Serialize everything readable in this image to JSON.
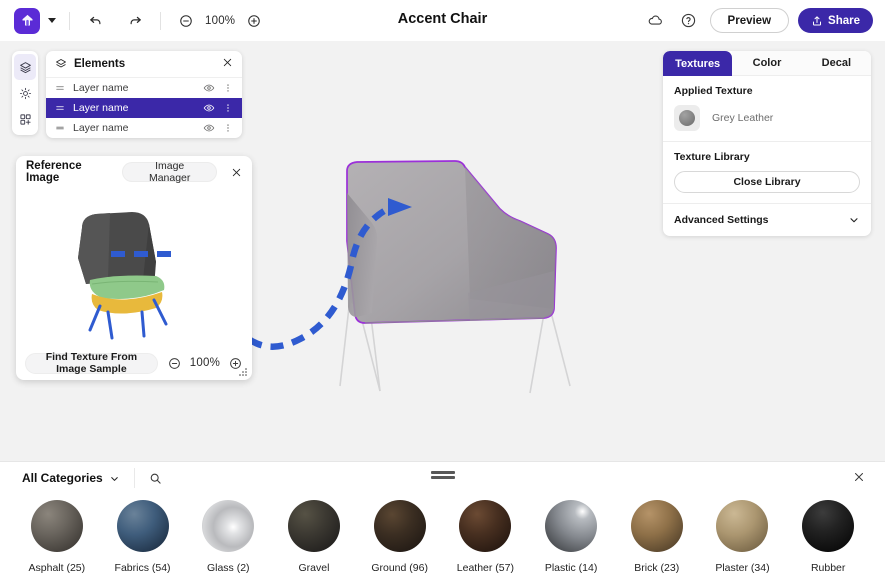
{
  "topbar": {
    "logo_icon": "app-logo-icon",
    "menu_caret_icon": "caret-down-icon",
    "undo_icon": "undo-icon",
    "redo_icon": "redo-icon",
    "zoom_out_icon": "minus-circle-icon",
    "zoom_in_icon": "plus-circle-icon",
    "zoom_level": "100%",
    "title": "Accent Chair",
    "cloud_icon": "cloud-icon",
    "help_icon": "question-circle-icon",
    "preview_label": "Preview",
    "share_label": "Share",
    "share_icon": "share-upload-icon"
  },
  "rail": {
    "items": [
      {
        "name": "layers-stack-icon",
        "active": true
      },
      {
        "name": "lighting-sun-icon",
        "active": false
      },
      {
        "name": "grid-apps-icon",
        "active": false
      }
    ]
  },
  "elements": {
    "header_icon": "layers-stack-icon",
    "title": "Elements",
    "close_icon": "close-icon",
    "rows": [
      {
        "label": "Layer name",
        "selected": false
      },
      {
        "label": "Layer name",
        "selected": true
      },
      {
        "label": "Layer name",
        "selected": false
      }
    ],
    "drag_icon": "drag-handle-icon",
    "eye_icon": "eye-visible-icon",
    "more_icon": "more-vertical-icon"
  },
  "reference": {
    "title": "Reference Image",
    "image_manager_label": "Image Manager",
    "close_icon": "close-icon",
    "find_texture_label": "Find Texture From Image Sample",
    "zoom_out_icon": "minus-circle-icon",
    "zoom_in_icon": "plus-circle-icon",
    "zoom_level": "100%",
    "resize_grip_icon": "resize-grip-icon",
    "thumbnail_alt": "reference-chair-photo"
  },
  "rightpanel": {
    "tabs": [
      {
        "label": "Textures",
        "active": true
      },
      {
        "label": "Color",
        "active": false
      },
      {
        "label": "Decal",
        "active": false
      }
    ],
    "applied_texture_label": "Applied Texture",
    "applied_texture_name": "Grey Leather",
    "applied_texture_swatch_color": "#8a8a8a",
    "texture_library_label": "Texture Library",
    "close_library_label": "Close Library",
    "advanced_settings_label": "Advanced Settings",
    "chevron_icon": "chevron-down-icon"
  },
  "canvas": {
    "model_alt": "accent-chair-3d-model",
    "selection_outline_color": "#9b30d9",
    "annotation_arrow_color": "#2f5bd0",
    "background_color": "#f2f2f2"
  },
  "bottom": {
    "category_label": "All Categories",
    "category_caret_icon": "chevron-down-icon",
    "search_icon": "search-icon",
    "drag_handle_icon": "drag-handle-horizontal-icon",
    "close_icon": "close-icon",
    "materials": [
      {
        "label": "Asphalt (25)",
        "color": "#5e5a54"
      },
      {
        "label": "Fabrics (54)",
        "color": "#3a5570"
      },
      {
        "label": "Glass (2)",
        "color": "#cfd0d2"
      },
      {
        "label": "Gravel",
        "color": "#3a382f"
      },
      {
        "label": "Ground (96)",
        "color": "#2e2620"
      },
      {
        "label": "Leather (57)",
        "color": "#3d2a1f"
      },
      {
        "label": "Plastic (14)",
        "color": "#7e8186"
      },
      {
        "label": "Brick (23)",
        "color": "#8a6f4c"
      },
      {
        "label": "Plaster (34)",
        "color": "#a89070"
      },
      {
        "label": "Rubber",
        "color": "#14100f"
      }
    ]
  }
}
